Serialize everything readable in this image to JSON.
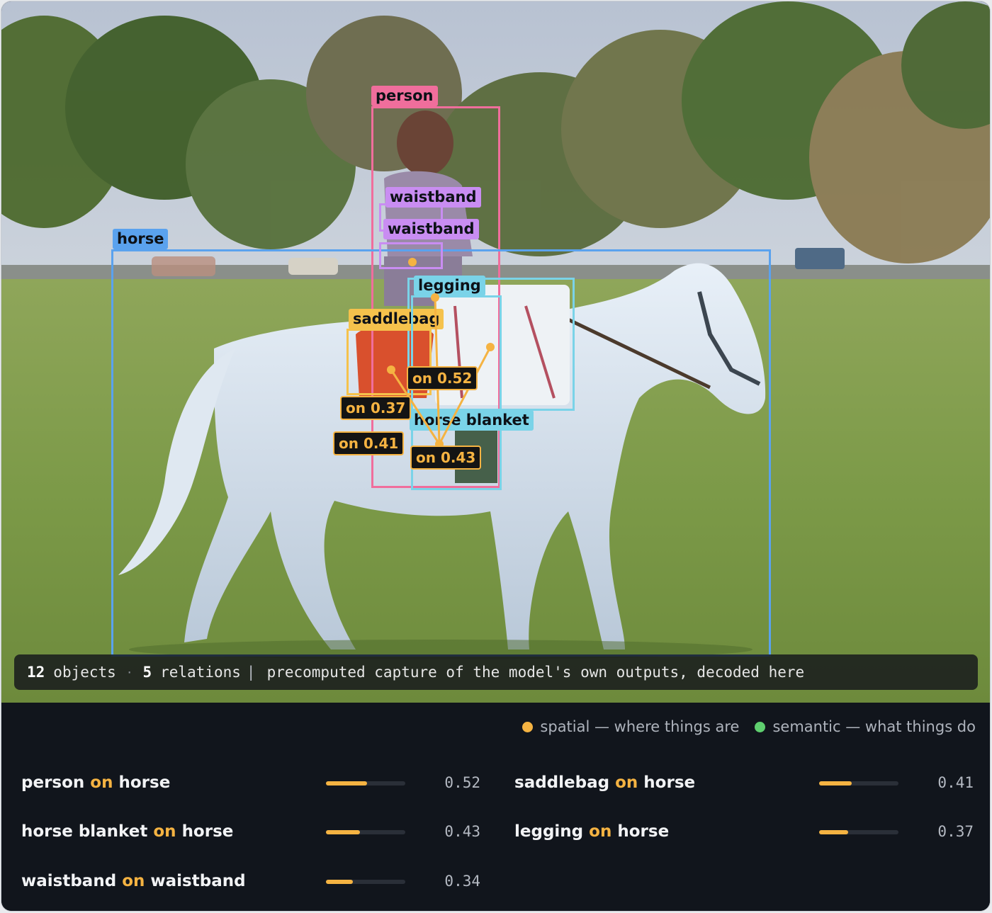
{
  "annotations": {
    "boxes": [
      {
        "label": "person",
        "color": "#f06e9c"
      },
      {
        "label": "horse",
        "color": "#5aa2ee"
      },
      {
        "label": "waistband",
        "color": "#c98df2"
      },
      {
        "label": "waistband",
        "color": "#c98df2"
      },
      {
        "label": "legging",
        "color": "#7ad3e8"
      },
      {
        "label": "saddlebag",
        "color": "#f5c24c"
      },
      {
        "label": "horse blanket",
        "color": "#7ad3e8"
      }
    ],
    "relation_labels": [
      "on 0.52",
      "on 0.37",
      "on 0.41",
      "on 0.43"
    ]
  },
  "status": {
    "objects_count": "12",
    "objects_word": "objects",
    "separator": "·",
    "relations_count": "5",
    "relations_word": "relations",
    "divider": "|",
    "note": "precomputed capture of the model's own outputs, decoded here"
  },
  "legend": {
    "spatial": {
      "label": "spatial — where things are",
      "color": "#f5b342"
    },
    "semantic": {
      "label": "semantic — what things do",
      "color": "#5fcf6f"
    }
  },
  "relations": [
    {
      "subject": "person",
      "predicate": "on",
      "object": "horse",
      "score": "0.52",
      "strength": 0.52
    },
    {
      "subject": "saddlebag",
      "predicate": "on",
      "object": "horse",
      "score": "0.41",
      "strength": 0.41
    },
    {
      "subject": "horse blanket",
      "predicate": "on",
      "object": "horse",
      "score": "0.43",
      "strength": 0.43
    },
    {
      "subject": "legging",
      "predicate": "on",
      "object": "horse",
      "score": "0.37",
      "strength": 0.37
    },
    {
      "subject": "waistband",
      "predicate": "on",
      "object": "waistband",
      "score": "0.34",
      "strength": 0.34
    }
  ]
}
